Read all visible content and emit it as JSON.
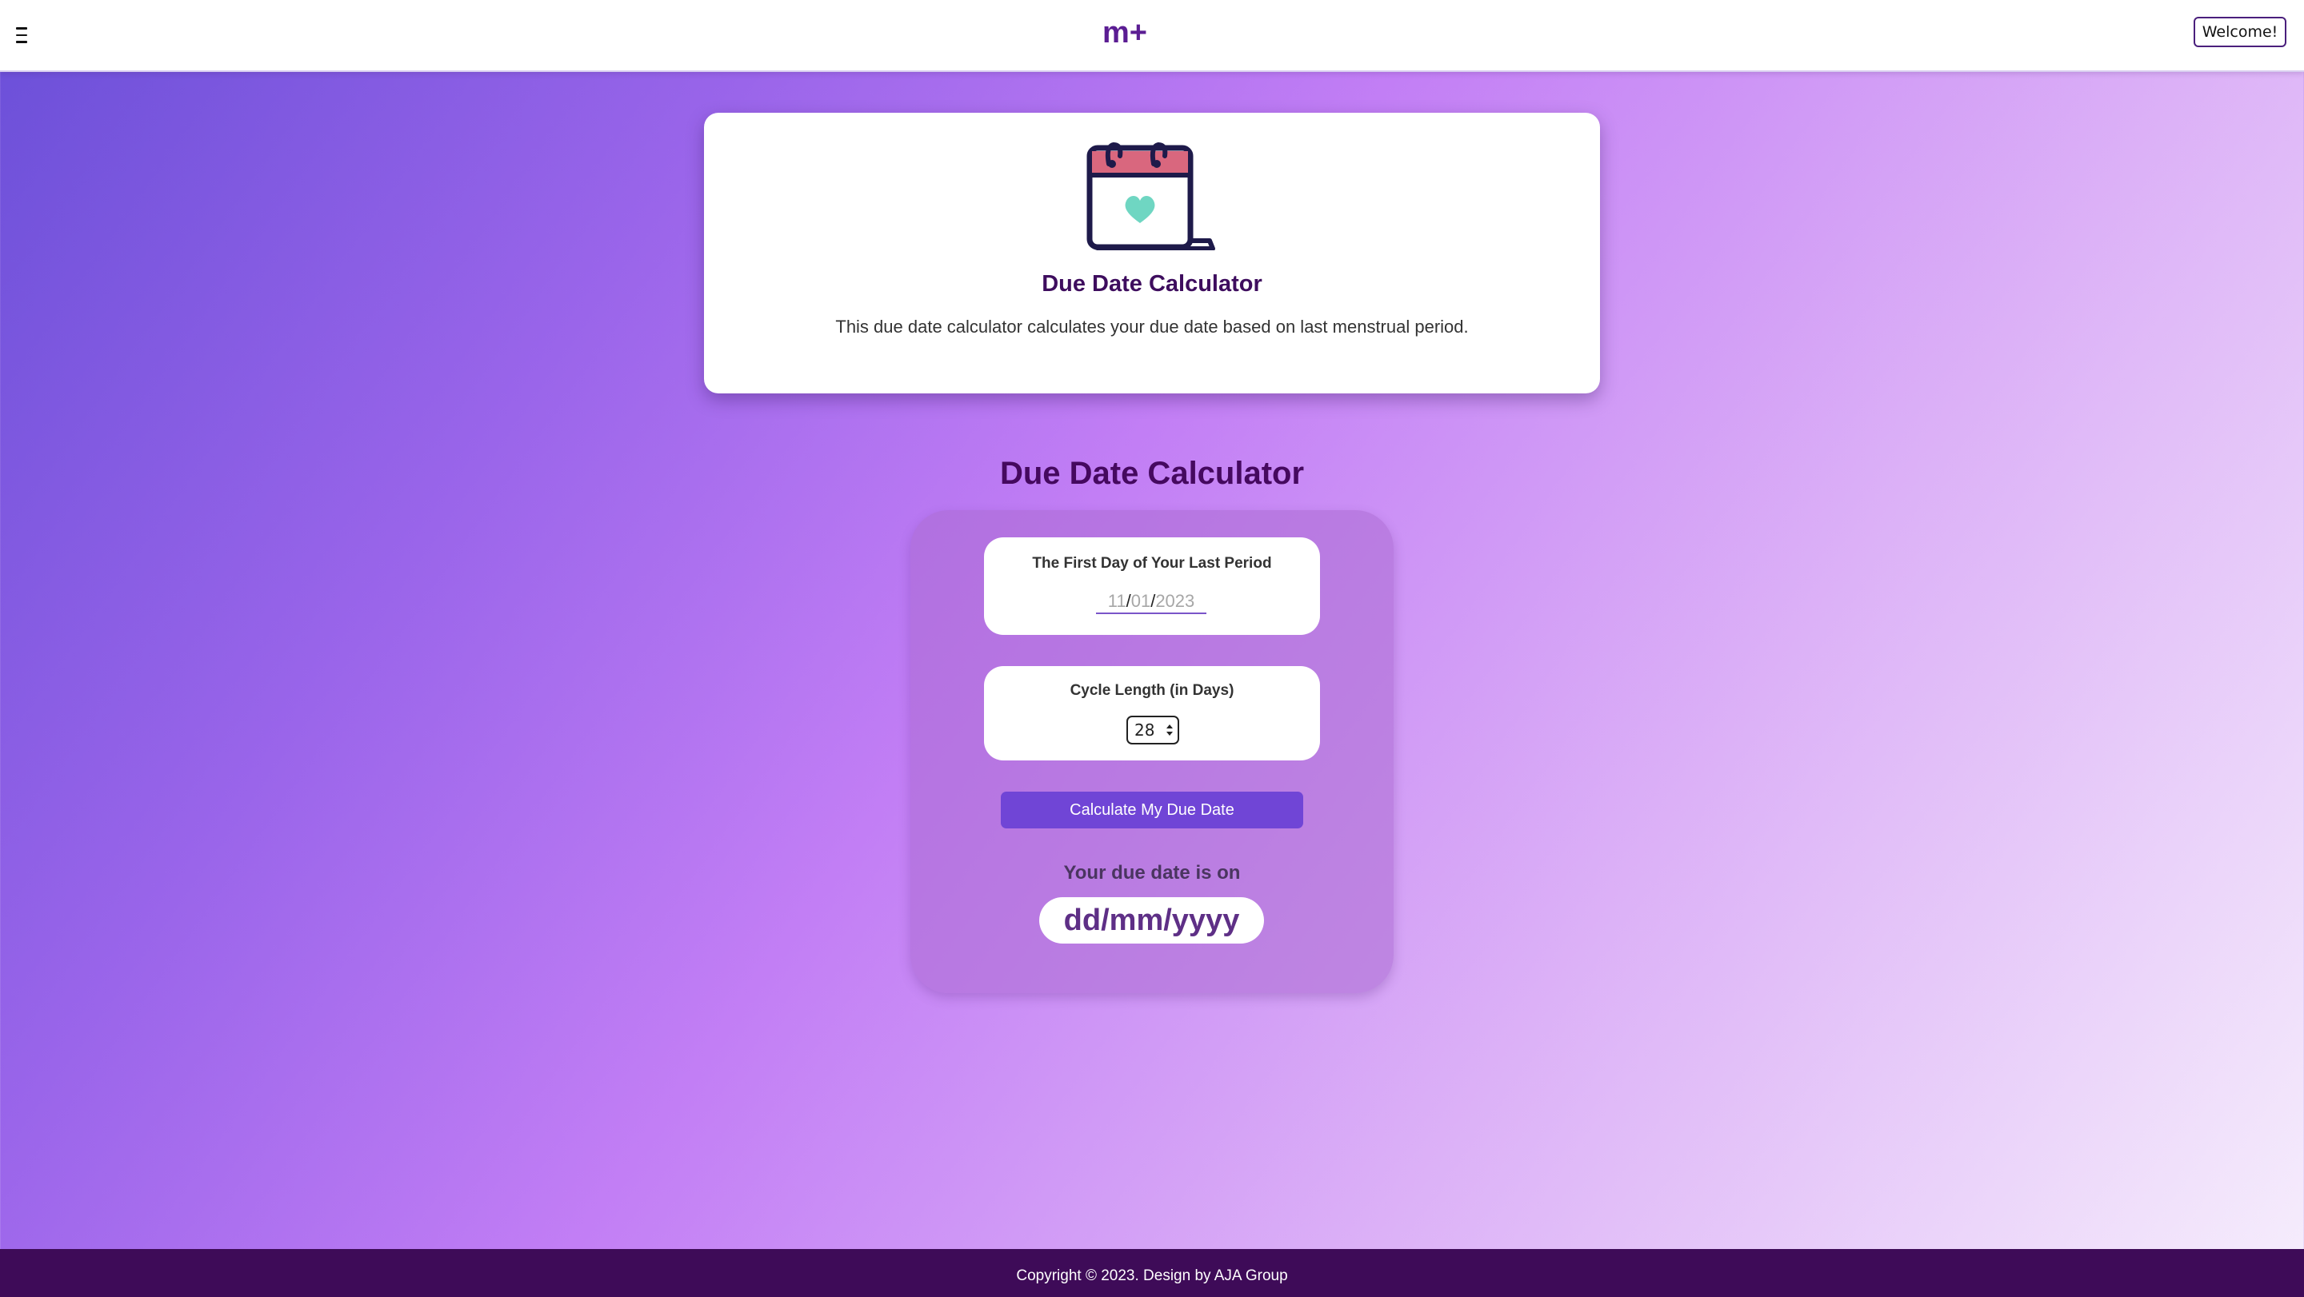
{
  "header": {
    "menu_icon": "hamburger-menu-icon",
    "logo_text": "m+",
    "logo_color": "#5b1d93",
    "welcome_label": "Welcome!"
  },
  "intro": {
    "icon": "calendar-heart-icon",
    "title": "Due Date Calculator",
    "description": "This due date calculator calculates your due date based on last menstrual period."
  },
  "calculator": {
    "heading": "Due Date Calculator",
    "last_period": {
      "label": "The First Day of Your Last Period",
      "month": "11",
      "day": "01",
      "year": "2023",
      "separator": "/"
    },
    "cycle": {
      "label": "Cycle Length (in Days)",
      "selected": "28"
    },
    "button_label": "Calculate My Due Date",
    "result_label": "Your due date is on",
    "result_value": "dd/mm/yyyy"
  },
  "footer": {
    "copyright": "Copyright © 2023. Design by AJA Group"
  },
  "colors": {
    "accent": "#7045d6",
    "heading": "#45095f",
    "footer_bg": "#3e0b58",
    "calendar_stroke": "#1e1a4a",
    "calendar_top": "#d9677e",
    "heart": "#6fd6c2"
  }
}
